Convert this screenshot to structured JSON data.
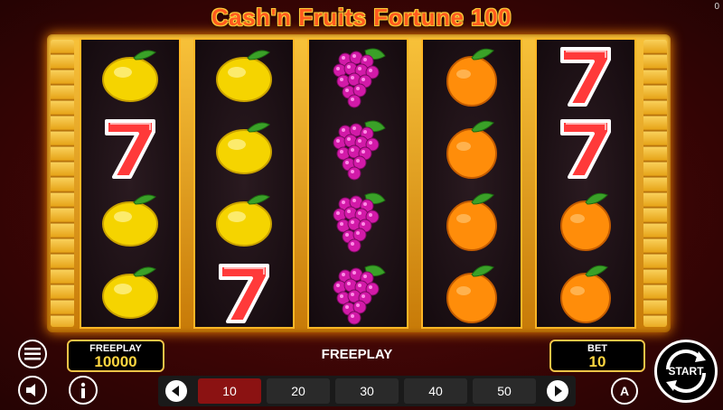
{
  "corner_counter": "0",
  "title": "Cash'n Fruits Fortune 100",
  "reels": [
    [
      "lemon",
      "seven",
      "lemon",
      "lemon"
    ],
    [
      "lemon",
      "lemon",
      "lemon",
      "seven"
    ],
    [
      "grapes",
      "grapes",
      "grapes",
      "grapes"
    ],
    [
      "orange",
      "orange",
      "orange",
      "orange"
    ],
    [
      "seven",
      "seven",
      "orange",
      "orange"
    ]
  ],
  "freeplay_box": {
    "label": "FREEPLAY",
    "value": "10000"
  },
  "mode_label": "FREEPLAY",
  "bet_box": {
    "label": "BET",
    "value": "10"
  },
  "bet_options": [
    {
      "label": "10",
      "active": true
    },
    {
      "label": "20",
      "active": false
    },
    {
      "label": "30",
      "active": false
    },
    {
      "label": "40",
      "active": false
    },
    {
      "label": "50",
      "active": false
    }
  ],
  "start_label": "START",
  "auto_label": "A",
  "icons": {
    "menu": "hamburger-menu-icon",
    "sound": "speaker-icon",
    "info": "info-icon",
    "prev": "chevron-left-icon",
    "next": "chevron-right-icon"
  },
  "colors": {
    "gold": "#f2c447",
    "active_bet": "#8b1212",
    "title": "#ff5a1f"
  }
}
